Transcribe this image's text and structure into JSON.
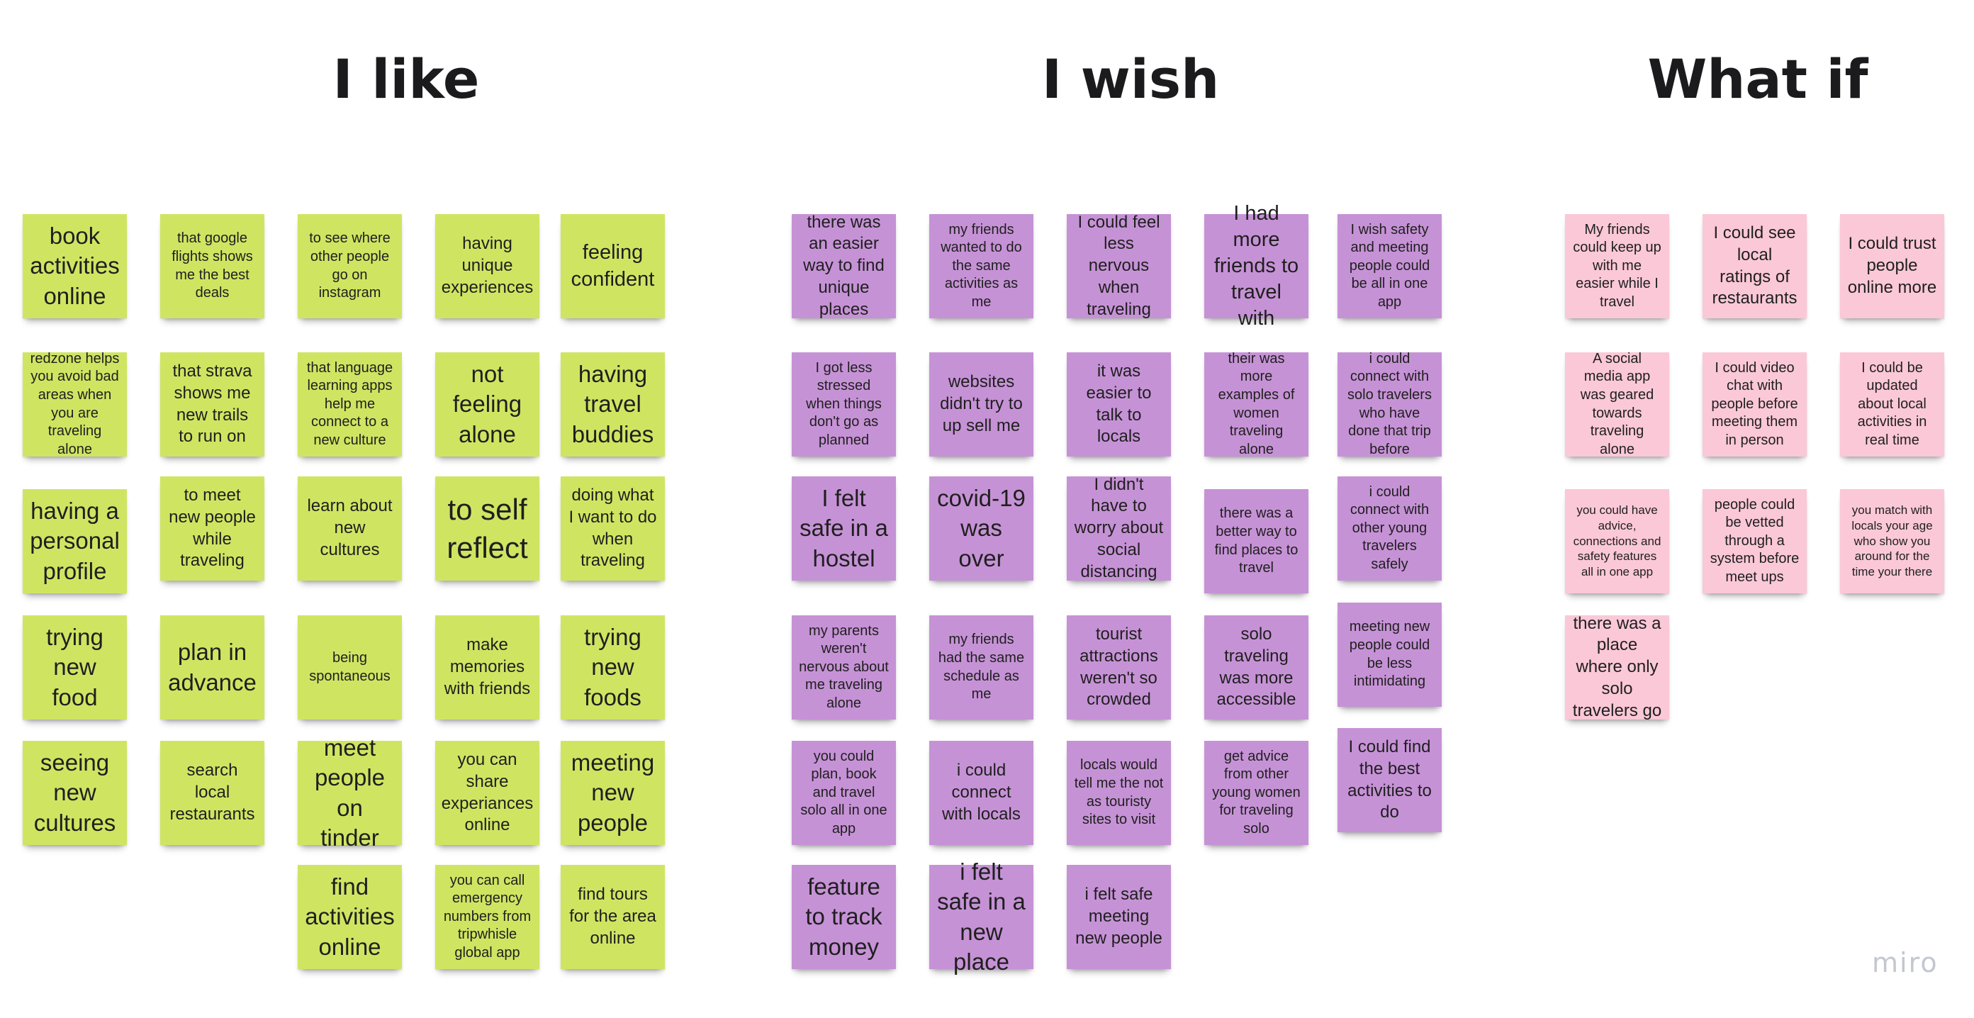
{
  "board": {
    "headings": {
      "like": "I like",
      "wish": "I wish",
      "what_if": "What if"
    },
    "logo": "miro"
  },
  "colors": {
    "like": "#cfe562",
    "wish": "#c692d6",
    "what_if": "#fbc8d8"
  },
  "notes": {
    "like": [
      "book activities online",
      "that google flights shows me the best deals",
      "to see where other people go on instagram",
      "having unique experiences",
      "feeling confident",
      "redzone helps you avoid bad areas when you are traveling alone",
      "that strava shows me new trails to run on",
      "that language learning apps help me connect to a new culture",
      "not feeling alone",
      "having travel buddies",
      "having a personal profile",
      "to meet new people while traveling",
      "learn about new cultures",
      "to self reflect",
      "doing what I want to do when traveling",
      "trying new food",
      "plan in advance",
      "being spontaneous",
      "make memories with friends",
      "trying new foods",
      "seeing new cultures",
      "search local restaurants",
      "meet people on tinder",
      "you can share experiances online",
      "meeting new people",
      "find activities online",
      "you can call emergency numbers from tripwhisle global app",
      "find tours for the area online"
    ],
    "wish": [
      "there was an easier way to find unique places",
      "my friends wanted to do the same activities as me",
      "I could feel less nervous when traveling",
      "I had more friends to travel with",
      "I wish safety and meeting people could be all in one app",
      "I got less stressed when things don't go as planned",
      "websites didn't try to up sell me",
      "it was easier to talk to locals",
      "their was more examples of women traveling alone",
      "i could connect with solo travelers who have done that trip before",
      "I felt safe in a hostel",
      "covid-19 was over",
      "I didn't have to worry about social distancing",
      "there was a better way to find places to travel",
      "i could connect with other young travelers safely",
      "my parents weren't nervous about me traveling alone",
      "my friends had the same schedule as me",
      "tourist attractions weren't so crowded",
      "solo traveling was more accessible",
      "meeting new people could be less intimidating",
      "you could plan, book and travel solo all in one app",
      "i could connect with locals",
      "locals would tell me the not as touristy sites to visit",
      "get advice from other young women for traveling solo",
      "I could find the best activities to do",
      "feature to track money",
      "i felt safe in a new place",
      "i felt safe meeting new people"
    ],
    "what_if": [
      "My friends could keep up with me easier while I travel",
      "I could see local ratings of restaurants",
      "I could trust people online more",
      "A social media app was geared towards traveling alone",
      "I could video chat with people before meeting them in person",
      "I could be updated about local activities in real time",
      "you could have advice, connections and safety features all in one app",
      "people could be vetted through a system before meet ups",
      "you match with locals your age who show you around for the time your there",
      "there was a place where only solo travelers go"
    ]
  }
}
